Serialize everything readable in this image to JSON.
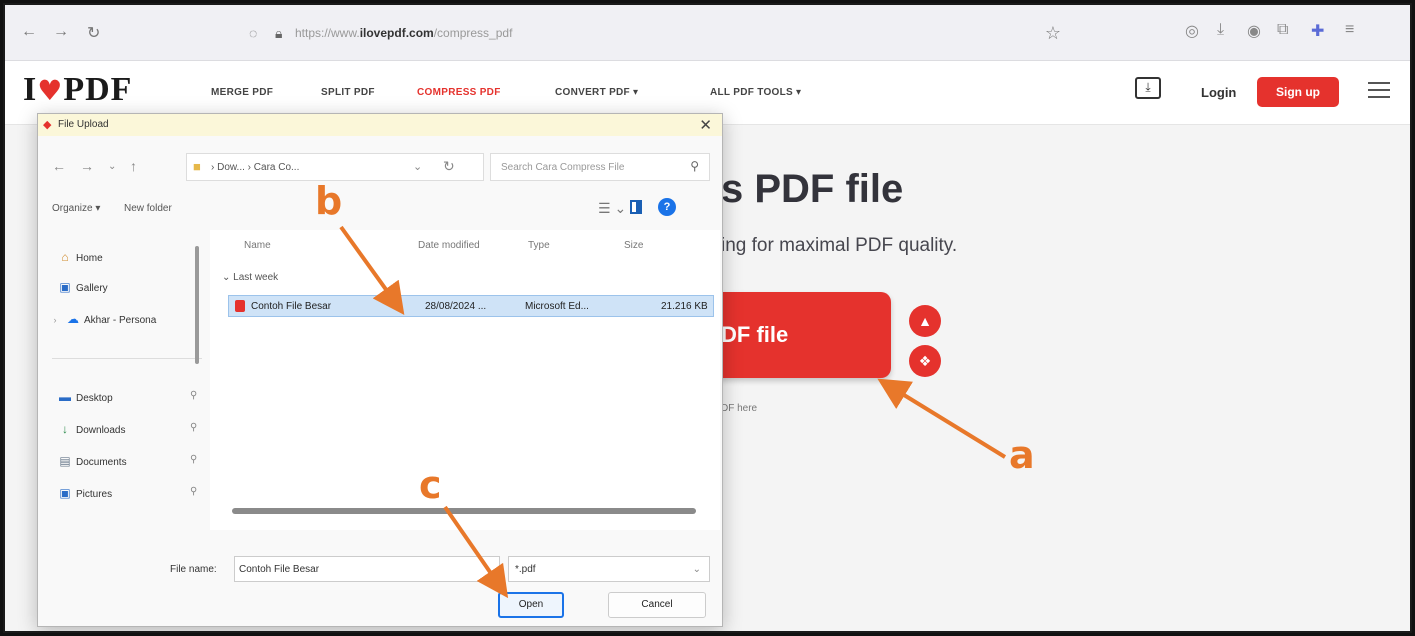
{
  "browser": {
    "url_prefix": "https://www.",
    "url_domain": "ilovepdf.com",
    "url_path": "/compress_pdf",
    "nav_back": "←",
    "nav_forward": "→",
    "nav_reload": "↻"
  },
  "site": {
    "logo_left": "I",
    "logo_heart": "♥",
    "logo_right": "PDF",
    "nav": [
      "MERGE PDF",
      "SPLIT PDF",
      "COMPRESS PDF",
      "CONVERT PDF ▾",
      "ALL PDF TOOLS ▾"
    ],
    "login": "Login",
    "signup": "Sign up"
  },
  "page": {
    "title_partial": "s PDF file",
    "subtitle_partial": "ing for maximal PDF quality.",
    "select_button_partial": "DF file",
    "drop_hint_partial": "DF here"
  },
  "dialog": {
    "title": "File Upload",
    "breadcrumb": "› Dow... › Cara Co...",
    "search_placeholder": "Search Cara Compress File",
    "organize": "Organize ▾",
    "new_folder": "New folder",
    "sidebar": [
      {
        "icon": "⌂",
        "label": "Home"
      },
      {
        "icon": "▣",
        "label": "Gallery"
      },
      {
        "icon": "☁",
        "label": "Akhar - Persona"
      },
      {
        "icon": "▬",
        "label": "Desktop"
      },
      {
        "icon": "↓",
        "label": "Downloads"
      },
      {
        "icon": "▤",
        "label": "Documents"
      },
      {
        "icon": "▣",
        "label": "Pictures"
      }
    ],
    "columns": [
      "Name",
      "Date modified",
      "Type",
      "Size"
    ],
    "group_label": "⌄ Last week",
    "file": {
      "name": "Contoh File Besar",
      "date": "28/08/2024 ...",
      "type": "Microsoft Ed...",
      "size": "21.216 KB"
    },
    "file_name_label": "File name:",
    "file_name_value": "Contoh File Besar",
    "file_type": "*.pdf",
    "open_label": "Open",
    "cancel_label": "Cancel"
  },
  "annotations": {
    "a": "a",
    "b": "b",
    "c": "c"
  },
  "colors": {
    "brand_red": "#e5322d",
    "annotation_orange": "#e8782a",
    "selection_blue": "#cfe3f7"
  }
}
